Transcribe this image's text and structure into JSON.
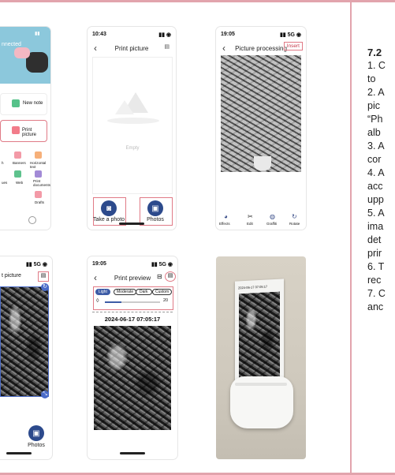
{
  "screen1": {
    "connected": "nnected",
    "cards": [
      "New note",
      "Print picture"
    ],
    "grid": [
      "h",
      "Banners",
      "Horizontal text",
      "ues",
      "Web",
      "Print documents",
      "Drafts"
    ]
  },
  "screen2": {
    "time": "10:43",
    "title": "Print picture",
    "empty": "Empty",
    "take_photo": "Take a photo",
    "photos": "Photos"
  },
  "screen3": {
    "time": "19:05",
    "title": "Picture processing",
    "insert": "Insert",
    "tools": [
      "Effects",
      "Edit",
      "Graffiti",
      "Rotate"
    ]
  },
  "screen4": {
    "title": "t picture",
    "photos": "Photos"
  },
  "screen5": {
    "time": "19:05",
    "title": "Print preview",
    "modes": [
      "Light",
      "Moderate",
      "Dark",
      "Custom"
    ],
    "slider_value": "20",
    "timestamp": "2024-06-17 07:05:17"
  },
  "screen6": {
    "print_stamp": "2024-06-17 07:05:17"
  },
  "text_column": {
    "lines": [
      "7.2",
      "1. C",
      "to",
      "2. A",
      "pic",
      "“Ph",
      "alb",
      "3. A",
      "cor",
      "4. A",
      "acc",
      "upp",
      "5. A",
      "ima",
      "det",
      "prir",
      "6. T",
      "rec",
      "7. C",
      "anc"
    ]
  }
}
